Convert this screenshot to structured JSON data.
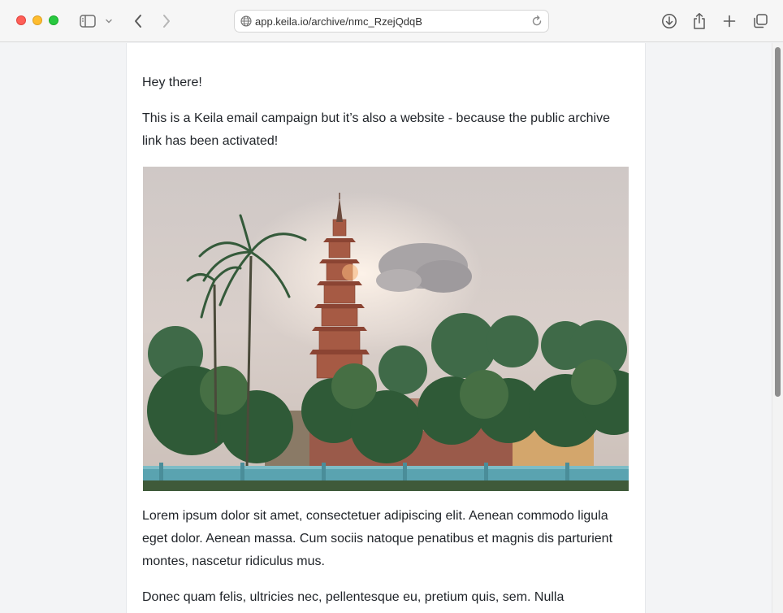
{
  "browser": {
    "url": "app.keila.io/archive/nmc_RzejQdqB",
    "icons": {
      "sidebar": "sidebar-icon",
      "sidebar_menu": "chevron-down-icon",
      "back": "back-arrow-icon",
      "forward": "forward-arrow-icon",
      "site": "globe-icon",
      "reload": "reload-icon",
      "downloads": "download-icon",
      "share": "share-icon",
      "new_tab": "plus-icon",
      "tabs": "tab-overview-icon"
    }
  },
  "email": {
    "greeting": "Hey there!",
    "intro": "This is a Keila email campaign but it’s also a website - because the public archive link has been activated!",
    "image_subject": "pagoda-with-palm-trees-photo",
    "body1": "Lorem ipsum dolor sit amet, consectetuer adipiscing elit. Aenean commodo ligula eget dolor. Aenean massa. Cum sociis natoque penatibus et magnis dis parturient montes, nascetur ridiculus mus.",
    "body2": "Donec quam felis, ultricies nec, pellentesque eu, pretium quis, sem. Nulla"
  },
  "colors": {
    "page_bg": "#f3f4f6",
    "text": "#1f2328",
    "close": "#fe5f57",
    "minimize": "#febc2e",
    "maximize": "#28c840"
  }
}
